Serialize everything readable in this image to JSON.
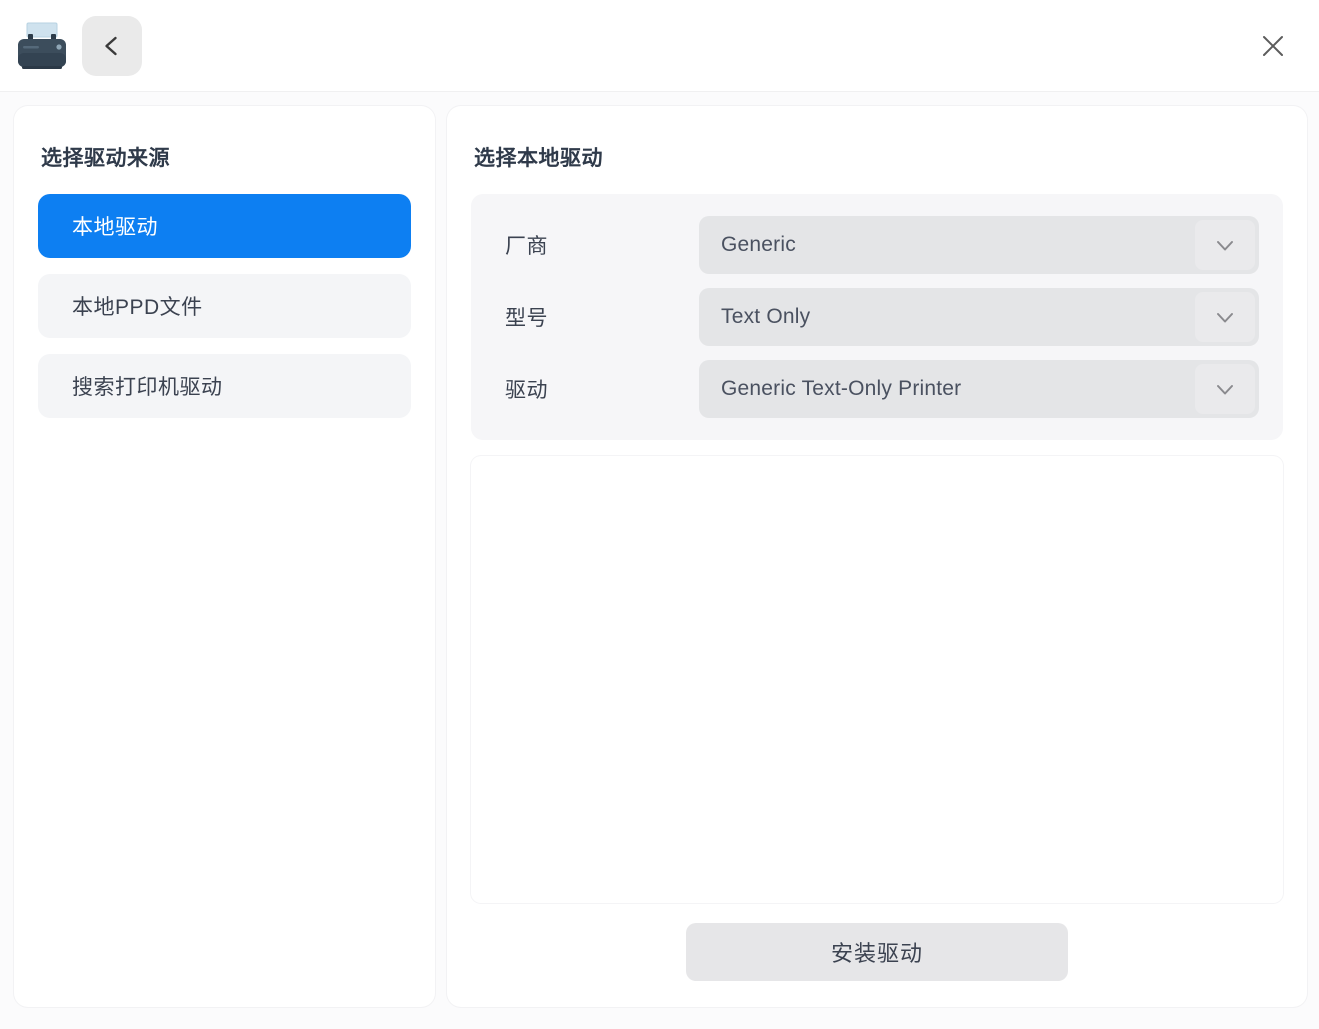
{
  "titlebar": {
    "app_icon": "printer-icon",
    "back_icon": "chevron-left-icon",
    "close_icon": "close-icon"
  },
  "sidebar": {
    "title": "选择驱动来源",
    "items": [
      {
        "label": "本地驱动",
        "selected": true
      },
      {
        "label": "本地PPD文件",
        "selected": false
      },
      {
        "label": "搜索打印机驱动",
        "selected": false
      }
    ]
  },
  "main": {
    "title": "选择本地驱动",
    "fields": [
      {
        "label": "厂商",
        "value": "Generic",
        "arrow_icon": "chevron-down-icon"
      },
      {
        "label": "型号",
        "value": "Text Only",
        "arrow_icon": "chevron-down-icon"
      },
      {
        "label": "驱动",
        "value": "Generic Text-Only Printer",
        "arrow_icon": "chevron-down-icon"
      }
    ],
    "result_area_text": "",
    "install_button_label": "安装驱动"
  },
  "colors": {
    "accent": "#0d7ff2",
    "window_bg": "#fbfbfc",
    "card_bg": "#ffffff",
    "field_bg": "#e4e5e7",
    "form_bg": "#f6f6f8",
    "item_bg": "#f4f5f7",
    "button_bg": "#e6e6e8",
    "text_primary": "#3b4250",
    "text_title": "#2f3a4a"
  }
}
